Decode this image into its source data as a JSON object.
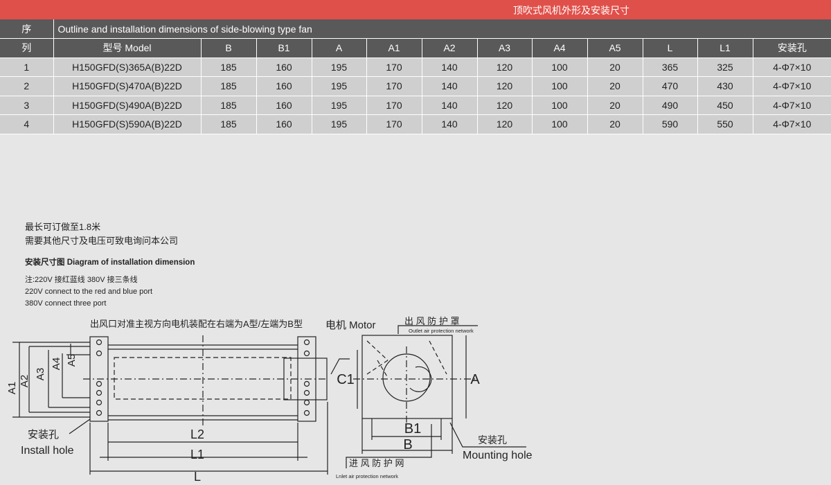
{
  "banner": {
    "title": "顶吹式风机外形及安装尺寸"
  },
  "table": {
    "seq_label_1": "序",
    "seq_label_2": "列",
    "caption": "Outline and installation dimensions of side-blowing type fan",
    "headers": [
      "型号 Model",
      "B",
      "B1",
      "A",
      "A1",
      "A2",
      "A3",
      "A4",
      "A5",
      "L",
      "L1",
      "安装孔"
    ],
    "rows": [
      [
        "1",
        "H150GFD(S)365A(B)22D",
        "185",
        "160",
        "195",
        "170",
        "140",
        "120",
        "100",
        "20",
        "365",
        "325",
        "4-Φ7×10"
      ],
      [
        "2",
        "H150GFD(S)470A(B)22D",
        "185",
        "160",
        "195",
        "170",
        "140",
        "120",
        "100",
        "20",
        "470",
        "430",
        "4-Φ7×10"
      ],
      [
        "3",
        "H150GFD(S)490A(B)22D",
        "185",
        "160",
        "195",
        "170",
        "140",
        "120",
        "100",
        "20",
        "490",
        "450",
        "4-Φ7×10"
      ],
      [
        "4",
        "H150GFD(S)590A(B)22D",
        "185",
        "160",
        "195",
        "170",
        "140",
        "120",
        "100",
        "20",
        "590",
        "550",
        "4-Φ7×10"
      ]
    ]
  },
  "notes": {
    "line1": "最长可订做至1.8米",
    "line2": "需要其他尺寸及电压可致电询问本公司",
    "diagram_title": "安装尺寸图 Diagram of installation dimension",
    "wiring_cn": "注:220V 接红蓝线   380V 接三条线",
    "wiring_220": "220V connect to the red and blue port",
    "wiring_380": "380V connect three port"
  },
  "diagram": {
    "outlet_note": "出风口对准主视方向电机装配在右端为A型/左端为B型",
    "motor_label": "电机 Motor",
    "outlet_cover_cn": "出 风 防 护 罩",
    "outlet_cover_en": "Outlet air protection network",
    "inlet_cn": "进 风 防 护 网",
    "inlet_en": "Lnlet air protection network",
    "install_hole_cn": "安装孔",
    "install_hole_en": "Install hole",
    "mounting_hole_cn": "安装孔",
    "mounting_hole_en": "Mounting hole",
    "dim_labels": {
      "a1": "A1",
      "a2": "A2",
      "a3": "A3",
      "a4": "A4",
      "a5": "A5",
      "l": "L",
      "l1": "L1",
      "l2": "L2",
      "c1": "C1",
      "a": "A",
      "b": "B",
      "b1": "B1"
    }
  }
}
